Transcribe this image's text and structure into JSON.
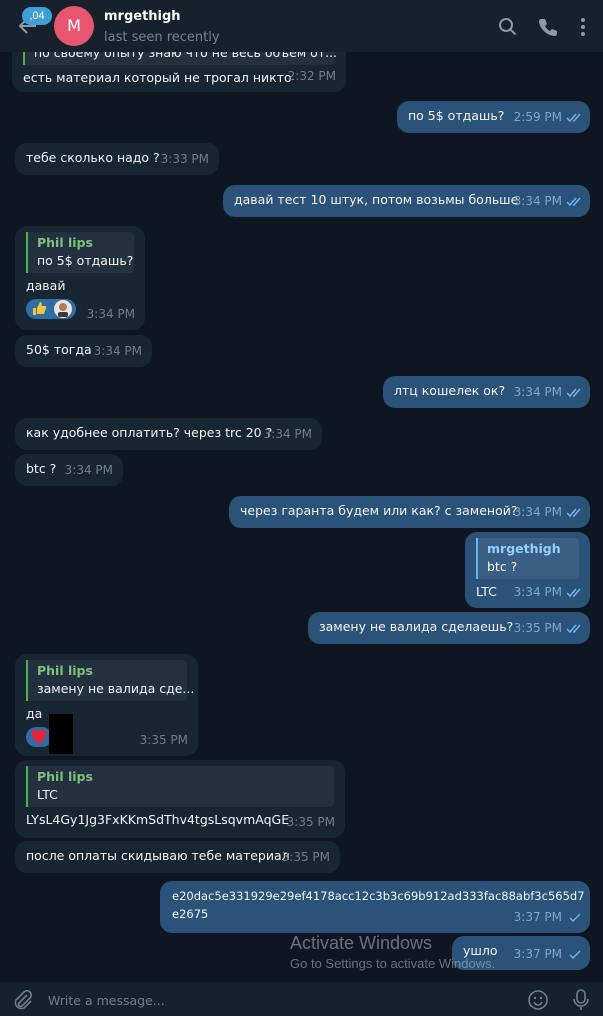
{
  "header": {
    "unread_badge": ",04",
    "avatar_letter": "M",
    "contact_name": "mrgethigh",
    "status": "last seen recently"
  },
  "colors": {
    "incoming_bubble": "#182533",
    "outgoing_bubble": "#2b5278",
    "accent": "#3e9fd6",
    "avatar": "#e8556f"
  },
  "messages": [
    {
      "dir": "in",
      "quote_partial": "по своему опыту знаю что не весь объем от...",
      "text": "есть материал который не трогал никто",
      "time": "2:32 PM"
    },
    {
      "dir": "out",
      "text": "по 5$ отдашь?",
      "time": "2:59 PM"
    },
    {
      "dir": "in",
      "text": "тебе сколько надо ?",
      "time": "3:33 PM"
    },
    {
      "dir": "out",
      "text": "давай тест 10 штук, потом возьмы больше",
      "time": "3:34 PM"
    },
    {
      "dir": "in",
      "quote_name": "Phil lips",
      "quote_text": "по 5$ отдашь?",
      "text": "давай",
      "reactions": [
        "thumbs-up",
        "avatar"
      ],
      "time": "3:34 PM"
    },
    {
      "dir": "in",
      "text": "50$ тогда",
      "time": "3:34 PM"
    },
    {
      "dir": "out",
      "text": "лтц кошелек ок?",
      "time": "3:34 PM"
    },
    {
      "dir": "in",
      "text": "как удобнее оплатить? через trc 20 ?",
      "time": "3:34 PM"
    },
    {
      "dir": "in",
      "text": "btc ?",
      "time": "3:34 PM"
    },
    {
      "dir": "out",
      "text": "через гаранта будем или как? с заменой?",
      "time": "3:34 PM"
    },
    {
      "dir": "out",
      "quote_name": "mrgethigh",
      "quote_text": "btc ?",
      "text": "LTC",
      "time": "3:34 PM"
    },
    {
      "dir": "out",
      "text": "замену не валида сделаешь?",
      "time": "3:35 PM"
    },
    {
      "dir": "in",
      "quote_name": "Phil lips",
      "quote_text": "замену не валида сде...",
      "text": "да",
      "reactions": [
        "heart"
      ],
      "time": "3:35 PM"
    },
    {
      "dir": "in",
      "quote_name": "Phil lips",
      "quote_text": "LTC",
      "text": "LYsL4Gy1Jg3FxKKmSdThv4tgsLsqvmAqGE",
      "time": "3:35 PM"
    },
    {
      "dir": "in",
      "text": "после оплаты скидываю тебе материал",
      "time": "3:35 PM"
    },
    {
      "dir": "out",
      "text_line1": "e20dac5e331929e29ef4178acc12c3b3c69b912ad333fac88abf3c565d7",
      "text_line2": "e2675",
      "time": "3:37 PM"
    },
    {
      "dir": "out",
      "text": "ушло",
      "time": "3:37 PM"
    }
  ],
  "composer": {
    "placeholder": "Write a message..."
  },
  "watermark": {
    "line1": "Activate Windows",
    "line2": "Go to Settings to activate Windows."
  }
}
